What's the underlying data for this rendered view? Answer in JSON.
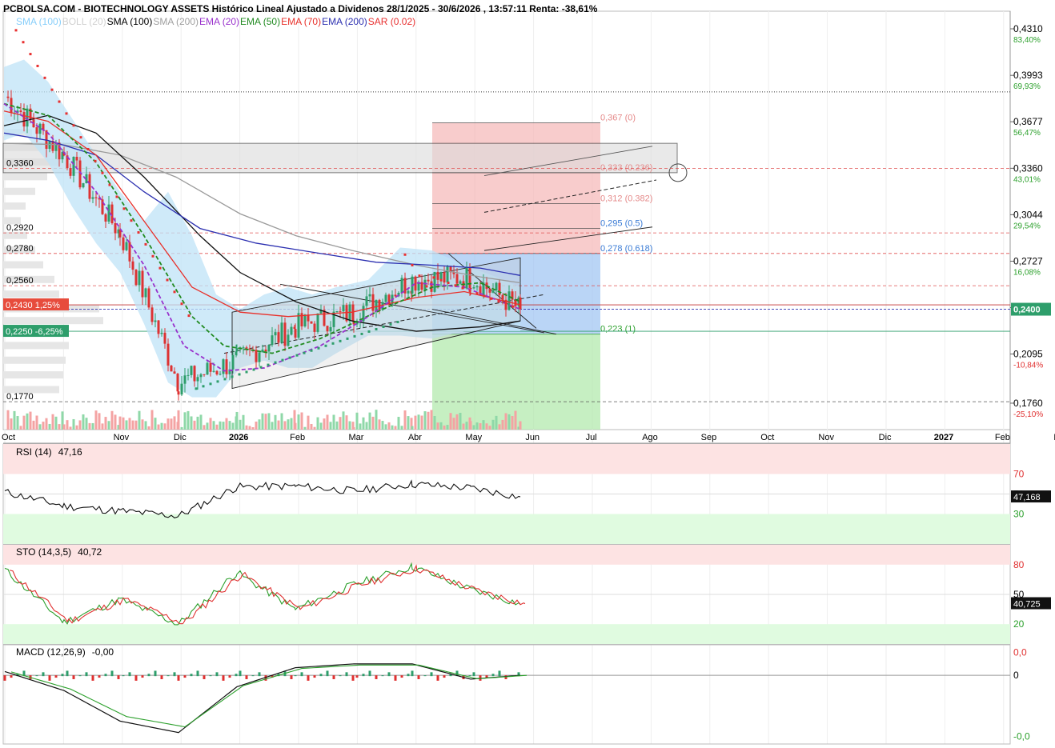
{
  "header": {
    "title": "PCBOLSA.COM - BIOTECHNOLOGY ASSETS Histórico Lineal Ajustado a Dividenos 28/1/2025 - 30/6/2026 , 13:57:11 Renta: -38,61%"
  },
  "legend": [
    {
      "label": "SMA (100)",
      "color": "#87cefa"
    },
    {
      "label": "BOLL (20)",
      "color": "#d0d0d0"
    },
    {
      "label": "SMA (100)",
      "color": "#000000"
    },
    {
      "label": "SMA (200)",
      "color": "#a0a0a0"
    },
    {
      "label": "EMA (20)",
      "color": "#9932cc"
    },
    {
      "label": "EMA (50)",
      "color": "#228b22"
    },
    {
      "label": "EMA (70)",
      "color": "#e8302a"
    },
    {
      "label": "EMA (200)",
      "color": "#2b2fb0"
    },
    {
      "label": "SAR (0.02)",
      "color": "#e83030"
    }
  ],
  "price_axis": {
    "ticks": [
      {
        "price": "0,4310",
        "pct": "83,40%"
      },
      {
        "price": "0,3993",
        "pct": "69,93%"
      },
      {
        "price": "0,3677",
        "pct": "56,47%"
      },
      {
        "price": "0,3360",
        "pct": "43,01%"
      },
      {
        "price": "0,3044",
        "pct": "29,54%"
      },
      {
        "price": "0,2727",
        "pct": "16,08%"
      },
      {
        "price": "0,2411",
        "pct": ""
      },
      {
        "price": "0,2095",
        "pct": "-10,84%"
      },
      {
        "price": "0,1760",
        "pct": "-25,10%"
      }
    ],
    "current_price": "0,2400"
  },
  "left_levels": [
    {
      "label": "0,3360",
      "value": 0.336
    },
    {
      "label": "0,2920",
      "value": 0.292
    },
    {
      "label": "0,2780",
      "value": 0.278
    },
    {
      "label": "0,2560",
      "value": 0.256
    },
    {
      "label": "0,1770",
      "value": 0.177
    }
  ],
  "left_badges": [
    {
      "label": "0,2430  1,25%",
      "value": 0.243,
      "color": "#e74c3c"
    },
    {
      "label": "0,2250  -6,25%",
      "value": 0.225,
      "color": "#2e9e6b"
    }
  ],
  "fib_levels": [
    {
      "label": "0,367 (0)",
      "value": 0.367,
      "color": "#e58a8a"
    },
    {
      "label": "0,333 (0.236)",
      "value": 0.333,
      "color": "#e58a8a"
    },
    {
      "label": "0,312 (0.382)",
      "value": 0.312,
      "color": "#e58a8a"
    },
    {
      "label": "0,295 (0.5)",
      "value": 0.295,
      "color": "#3a7bd5"
    },
    {
      "label": "0,278 (0.618)",
      "value": 0.278,
      "color": "#3a7bd5"
    },
    {
      "label": "0,223 (1)",
      "value": 0.223,
      "color": "#2ca02c"
    }
  ],
  "x_axis": {
    "labels": [
      "Oct",
      "Nov",
      "Dic",
      "2026",
      "Feb",
      "Mar",
      "Abr",
      "May",
      "Jun",
      "Jul",
      "Ago",
      "Sep",
      "Oct",
      "Nov",
      "Dic",
      "2027",
      "Feb",
      "Mar"
    ],
    "bold": [
      "2026",
      "2027"
    ]
  },
  "rsi": {
    "title": "RSI (14)",
    "value": "47,16",
    "badge": "47,168",
    "levels": [
      "70",
      "50",
      "30"
    ]
  },
  "sto": {
    "title": "STO (14,3,5)",
    "value": "40,72",
    "badge": "40,725",
    "levels": [
      "80",
      "50",
      "20"
    ]
  },
  "macd": {
    "title": "MACD (12,26,9)",
    "value": "-0,00",
    "levels": [
      "0,0",
      "0",
      "-0,0"
    ]
  },
  "chart_data": [
    {
      "type": "line",
      "title": "PCBOLSA.COM - BIOTECHNOLOGY ASSETS Histórico Lineal Ajustado a Dividenos 28/1/2025 - 30/6/2026 , 13:57:11 Renta: -38,61%",
      "x": [
        "Oct",
        "Nov",
        "Dic",
        "2026",
        "Feb",
        "Mar",
        "Abr",
        "May",
        "Jun",
        "Jul"
      ],
      "series": [
        {
          "name": "",
          "values": [
            0.385,
            0.345,
            0.292,
            0.19,
            0.205,
            0.228,
            0.238,
            0.26,
            0.262,
            0.24
          ]
        }
      ],
      "ylim": [
        0.158,
        0.443
      ]
    },
    {
      "type": "line",
      "title": "RSI (14)",
      "x": [
        "Oct",
        "Nov",
        "Dic",
        "2026",
        "Feb",
        "Mar",
        "Abr",
        "May",
        "Jun",
        "Jul"
      ],
      "series": [
        {
          "name": "",
          "values": [
            52,
            38,
            33,
            28,
            57,
            58,
            53,
            60,
            56,
            47.16
          ]
        }
      ],
      "ylim": [
        0,
        100
      ]
    },
    {
      "type": "line",
      "title": "STO (14,3,5)",
      "x": [
        "Oct",
        "Nov",
        "Dic",
        "2026",
        "Feb",
        "Mar",
        "Abr",
        "May",
        "Jun",
        "Jul"
      ],
      "series": [
        {
          "name": "",
          "values": [
            75,
            22,
            45,
            20,
            72,
            35,
            60,
            78,
            55,
            40.72
          ]
        }
      ],
      "ylim": [
        0,
        100
      ]
    },
    {
      "type": "line",
      "title": "MACD (12,26,9)",
      "x": [
        "Oct",
        "Nov",
        "Dic",
        "2026",
        "Feb",
        "Mar",
        "Abr",
        "May",
        "Jun",
        "Jul"
      ],
      "series": [
        {
          "name": "",
          "values": [
            0.001,
            -0.004,
            -0.012,
            -0.015,
            -0.003,
            0.002,
            0.003,
            0.003,
            -0.001,
            0.0
          ]
        }
      ]
    }
  ]
}
